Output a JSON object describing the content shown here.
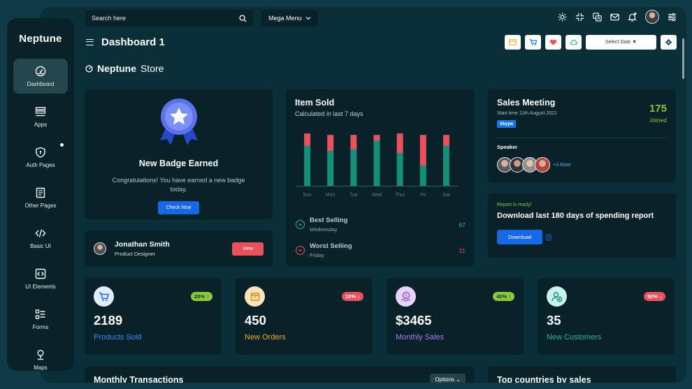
{
  "sidebar": {
    "logo": "Neptune",
    "items": [
      {
        "label": "Dashboard",
        "icon": "dashboard-gauge-icon",
        "active": true
      },
      {
        "label": "Apps",
        "icon": "apps-icon"
      },
      {
        "label": "Auth Pages",
        "icon": "shield-icon",
        "dot": true
      },
      {
        "label": "Other Pages",
        "icon": "page-icon"
      },
      {
        "label": "Basic UI",
        "icon": "code-icon"
      },
      {
        "label": "UI Elements",
        "icon": "code-box-icon"
      },
      {
        "label": "Forms",
        "icon": "forms-icon"
      },
      {
        "label": "Maps",
        "icon": "map-pin-icon"
      }
    ]
  },
  "topbar": {
    "search_placeholder": "Search here",
    "mega_menu": "Mega Menu"
  },
  "header": {
    "title": "Dashboard 1",
    "date_select": "Select Date ▼"
  },
  "store": {
    "name": "Neptune",
    "suffix": "Store"
  },
  "badge_card": {
    "title": "New Badge Earned",
    "text": "Congratulations! You have earned a new badge today.",
    "button": "Check Now"
  },
  "profile_card": {
    "name": "Jonathan Smith",
    "role": "Product Designer",
    "button": "View"
  },
  "item_sold": {
    "title": "Item Sold",
    "subtitle": "Calculated in last 7 days",
    "best": {
      "label": "Best Selling",
      "day": "Wednesday",
      "value": "67"
    },
    "worst": {
      "label": "Worst Selling",
      "day": "Friday",
      "value": "21"
    }
  },
  "chart_data": {
    "type": "bar",
    "stacked": true,
    "categories": [
      "Sun",
      "Mon",
      "Tue",
      "Wed",
      "Thur",
      "Fri",
      "Sat"
    ],
    "series": [
      {
        "values": [
          55,
          48,
          50,
          62,
          45,
          28,
          55
        ]
      },
      {
        "values": [
          17,
          22,
          20,
          8,
          27,
          42,
          15
        ]
      }
    ],
    "ylim": [
      0,
      75
    ]
  },
  "meeting": {
    "title": "Sales Meeting",
    "start": "Start time 11th August 2021",
    "tag": "Skype",
    "count": "175",
    "count_label": "Joined",
    "speaker_label": "Speaker",
    "more": "+3 More"
  },
  "report": {
    "kicker": "Report is ready!",
    "title": "Download last 180 days of spending report",
    "button": "Download"
  },
  "stats": [
    {
      "value": "2189",
      "label": "Products Sold",
      "pct": "20%",
      "trend": "up",
      "color": "#2f8cff",
      "icon": "cart-icon"
    },
    {
      "value": "450",
      "label": "New Orders",
      "pct": "10%",
      "trend": "down",
      "color": "#f5a623",
      "icon": "box-icon"
    },
    {
      "value": "$3465",
      "label": "Monthly Sales",
      "pct": "40%",
      "trend": "up",
      "color": "#b07cf0",
      "icon": "dollar-icon"
    },
    {
      "value": "35",
      "label": "New Customers",
      "pct": "50%",
      "trend": "down",
      "color": "#23b39a",
      "icon": "add-user-icon"
    }
  ],
  "bottom": {
    "left_title": "Monthly Transactions",
    "options": "Options",
    "right_title": "Top countries by sales"
  }
}
